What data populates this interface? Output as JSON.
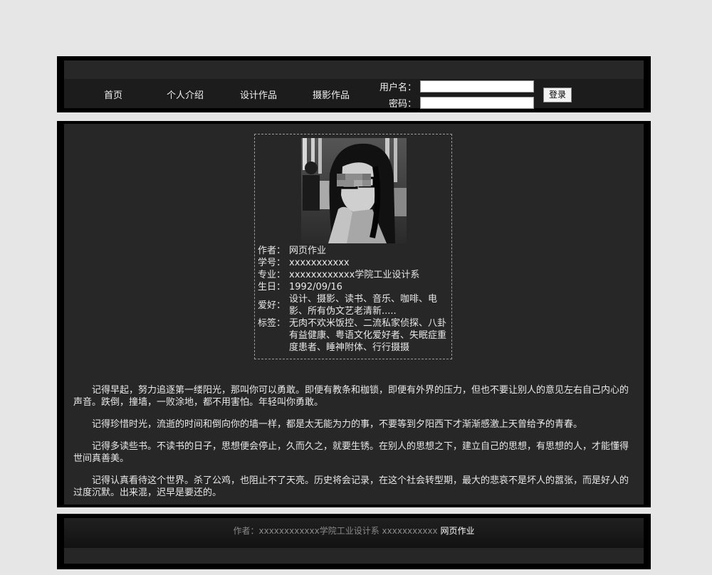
{
  "nav": {
    "items": [
      "首页",
      "个人介绍",
      "设计作品",
      "摄影作品"
    ]
  },
  "login": {
    "username_label": "用户名：",
    "password_label": "密码：",
    "username_value": "",
    "password_value": "",
    "submit_label": "登录"
  },
  "profile": {
    "author_label": "作者：",
    "author": "网页作业",
    "id_label": "学号：",
    "id": "xxxxxxxxxxx",
    "major_label": "专业：",
    "major": "xxxxxxxxxxxx学院工业设计系",
    "birthday_label": "生日：",
    "birthday": "1992/09/16",
    "hobby_label": "爱好：",
    "hobby": "设计、摄影、读书、音乐、咖啡、电影、所有伪文艺老清新.....",
    "tags_label": "标签：",
    "tags": "无肉不欢米饭控、二流私家侦探、八卦有益健康、粤语文化爱好者、失眠症重度患者、睡神附体、行行摄摄"
  },
  "paragraphs": [
    "记得早起，努力追逐第一缕阳光，那叫你可以勇敢。即便有教条和枷锁，即便有外界的压力，但也不要让别人的意见左右自己内心的声音。跌倒，撞墙，一败涂地，都不用害怕。年轻叫你勇敢。",
    "记得珍惜时光，流逝的时间和倒向你的墙一样，都是太无能为力的事，不要等到夕阳西下才渐渐感激上天曾给予的青春。",
    "记得多读些书。不读书的日子，思想便会停止，久而久之，就要生锈。在别人的思想之下，建立自己的思想，有思想的人，才能懂得世间真善美。",
    "记得认真看待这个世界。杀了公鸡，也阻止不了天亮。历史将会记录，在这个社会转型期，最大的悲哀不是坏人的嚣张，而是好人的过度沉默。出来混，迟早是要还的。"
  ],
  "footer": {
    "text": "作者：xxxxxxxxxxxx学院工业设计系 xxxxxxxxxxx",
    "author": "网页作业"
  }
}
